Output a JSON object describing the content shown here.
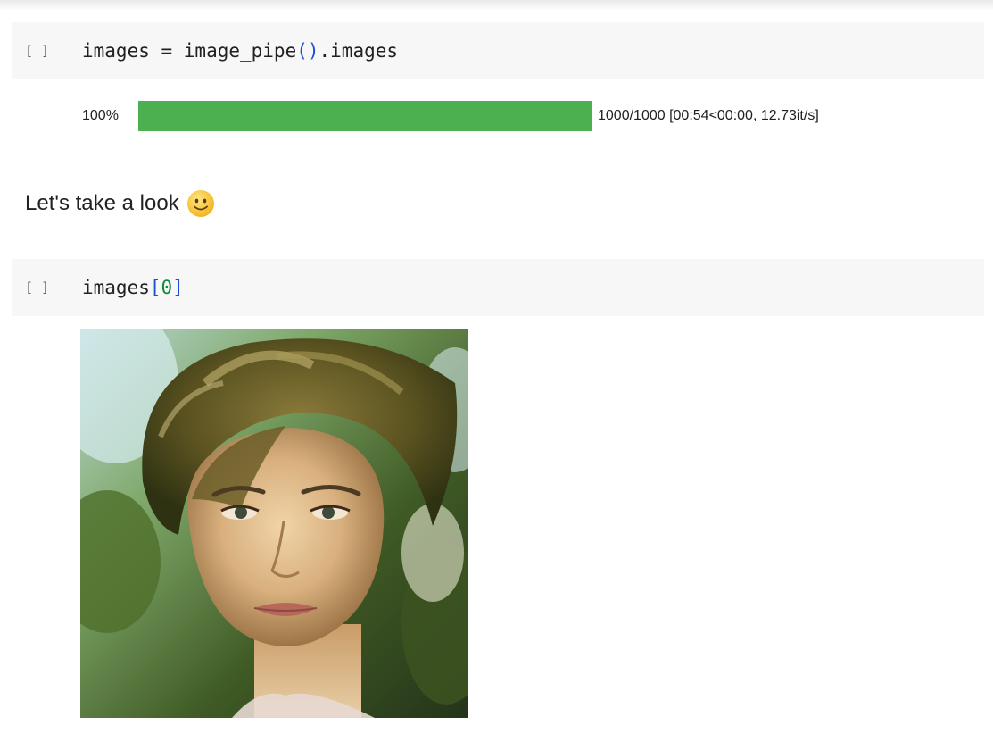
{
  "cell1": {
    "run_indicator": "[ ]",
    "code_before": "images = image_pipe",
    "code_paren": "()",
    "code_after": ".images"
  },
  "progress": {
    "percent_label": "100%",
    "fraction": 1.0,
    "stats": "1000/1000 [00:54<00:00, 12.73it/s]",
    "bar_color": "#4caf50"
  },
  "markdown": {
    "text": "Let's take a look",
    "emoji": "smiley-face-icon"
  },
  "cell2": {
    "run_indicator": "[ ]",
    "code_var": "images",
    "code_open": "[",
    "code_index": "0",
    "code_close": "]"
  },
  "output": {
    "image_subject": "generated portrait of a woman with windswept hair"
  }
}
